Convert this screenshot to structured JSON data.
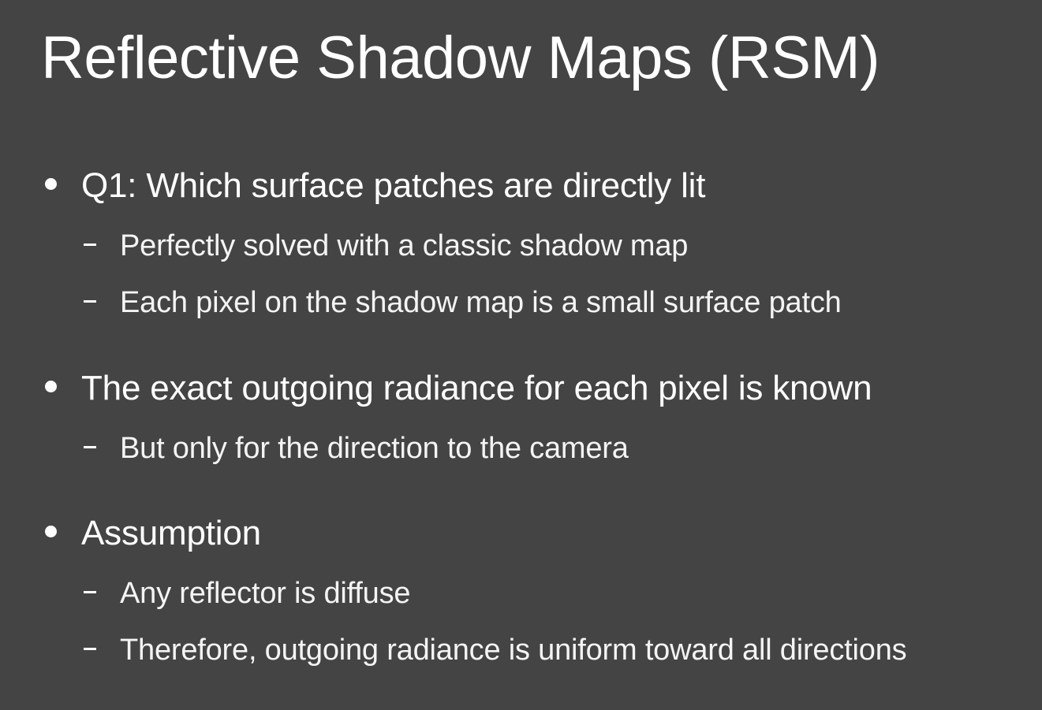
{
  "slide": {
    "title": "Reflective Shadow Maps (RSM)",
    "background_color": "#444444",
    "text_color": "#ffffff"
  },
  "bullets": [
    {
      "text": "Q1: Which surface patches are directly lit",
      "subs": [
        "Perfectly solved with a classic shadow map",
        "Each pixel on the shadow map is a small surface patch"
      ]
    },
    {
      "text": "The exact outgoing radiance for each pixel is known",
      "subs": [
        "But only for the direction to the camera"
      ]
    },
    {
      "text": "Assumption",
      "subs": [
        "Any reflector is diffuse",
        "Therefore, outgoing radiance is uniform toward all directions"
      ]
    }
  ]
}
